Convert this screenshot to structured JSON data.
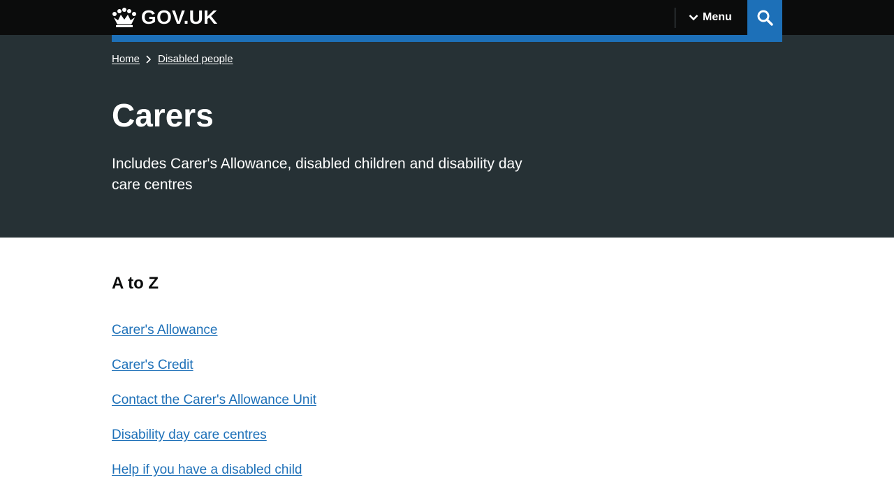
{
  "header": {
    "logo_text": "GOV.UK",
    "menu_label": "Menu",
    "colors": {
      "bar": "#0b0c0c",
      "accent": "#1d70b8"
    }
  },
  "breadcrumb": {
    "items": [
      {
        "label": "Home"
      },
      {
        "label": "Disabled people"
      }
    ]
  },
  "hero": {
    "title": "Carers",
    "description": "Includes Carer's Allowance, disabled children and disability day care centres",
    "background": "#263135"
  },
  "main": {
    "section_title": "A to Z",
    "links": [
      {
        "label": "Carer's Allowance"
      },
      {
        "label": "Carer's Credit"
      },
      {
        "label": "Contact the Carer's Allowance Unit"
      },
      {
        "label": "Disability day care centres"
      },
      {
        "label": "Help if you have a disabled child"
      }
    ]
  }
}
